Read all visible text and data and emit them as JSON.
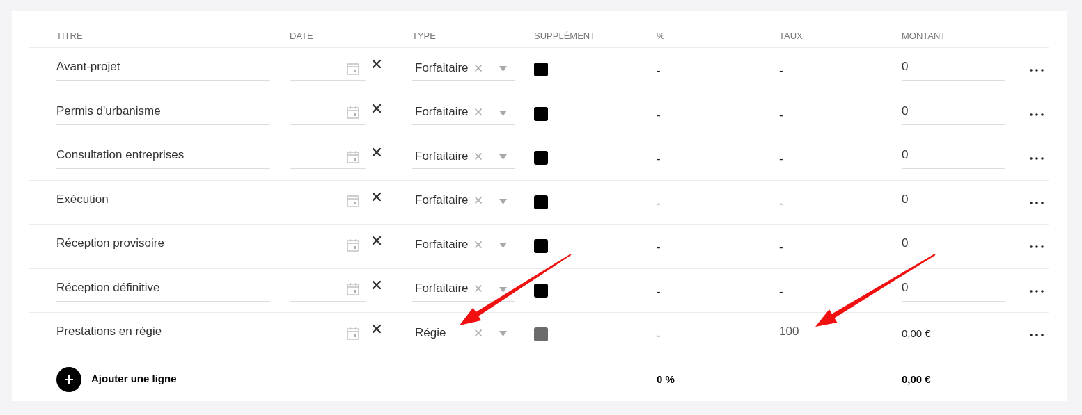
{
  "columns": [
    {
      "label": "TITRE"
    },
    {
      "label": "DATE"
    },
    {
      "label": "TYPE"
    },
    {
      "label": "SUPPLÉMENT"
    },
    {
      "label": "%"
    },
    {
      "label": "TAUX"
    },
    {
      "label": "MONTANT"
    }
  ],
  "rows": [
    {
      "title": "Avant-projet",
      "type": "Forfaitaire",
      "kind": "flat",
      "supplement_disabled": false,
      "percent": "-",
      "rate": "-",
      "amount": "0"
    },
    {
      "title": "Permis d'urbanisme",
      "type": "Forfaitaire",
      "kind": "flat",
      "supplement_disabled": false,
      "percent": "-",
      "rate": "-",
      "amount": "0"
    },
    {
      "title": "Consultation entreprises",
      "type": "Forfaitaire",
      "kind": "flat",
      "supplement_disabled": false,
      "percent": "-",
      "rate": "-",
      "amount": "0"
    },
    {
      "title": "Exécution",
      "type": "Forfaitaire",
      "kind": "flat",
      "supplement_disabled": false,
      "percent": "-",
      "rate": "-",
      "amount": "0"
    },
    {
      "title": "Réception provisoire",
      "type": "Forfaitaire",
      "kind": "flat",
      "supplement_disabled": false,
      "percent": "-",
      "rate": "-",
      "amount": "0"
    },
    {
      "title": "Réception définitive",
      "type": "Forfaitaire",
      "kind": "flat",
      "supplement_disabled": false,
      "percent": "-",
      "rate": "-",
      "amount": "0"
    },
    {
      "title": "Prestations en régie",
      "type": "Régie",
      "kind": "hourly",
      "supplement_disabled": true,
      "percent": "-",
      "rate": "100",
      "amount": "0,00 €"
    }
  ],
  "add_button": {
    "label": "Ajouter une ligne"
  },
  "totals": {
    "percent": "0 %",
    "amount": "0,00 €"
  },
  "annotations": {
    "type_arrow": true,
    "rate_arrow": true
  }
}
